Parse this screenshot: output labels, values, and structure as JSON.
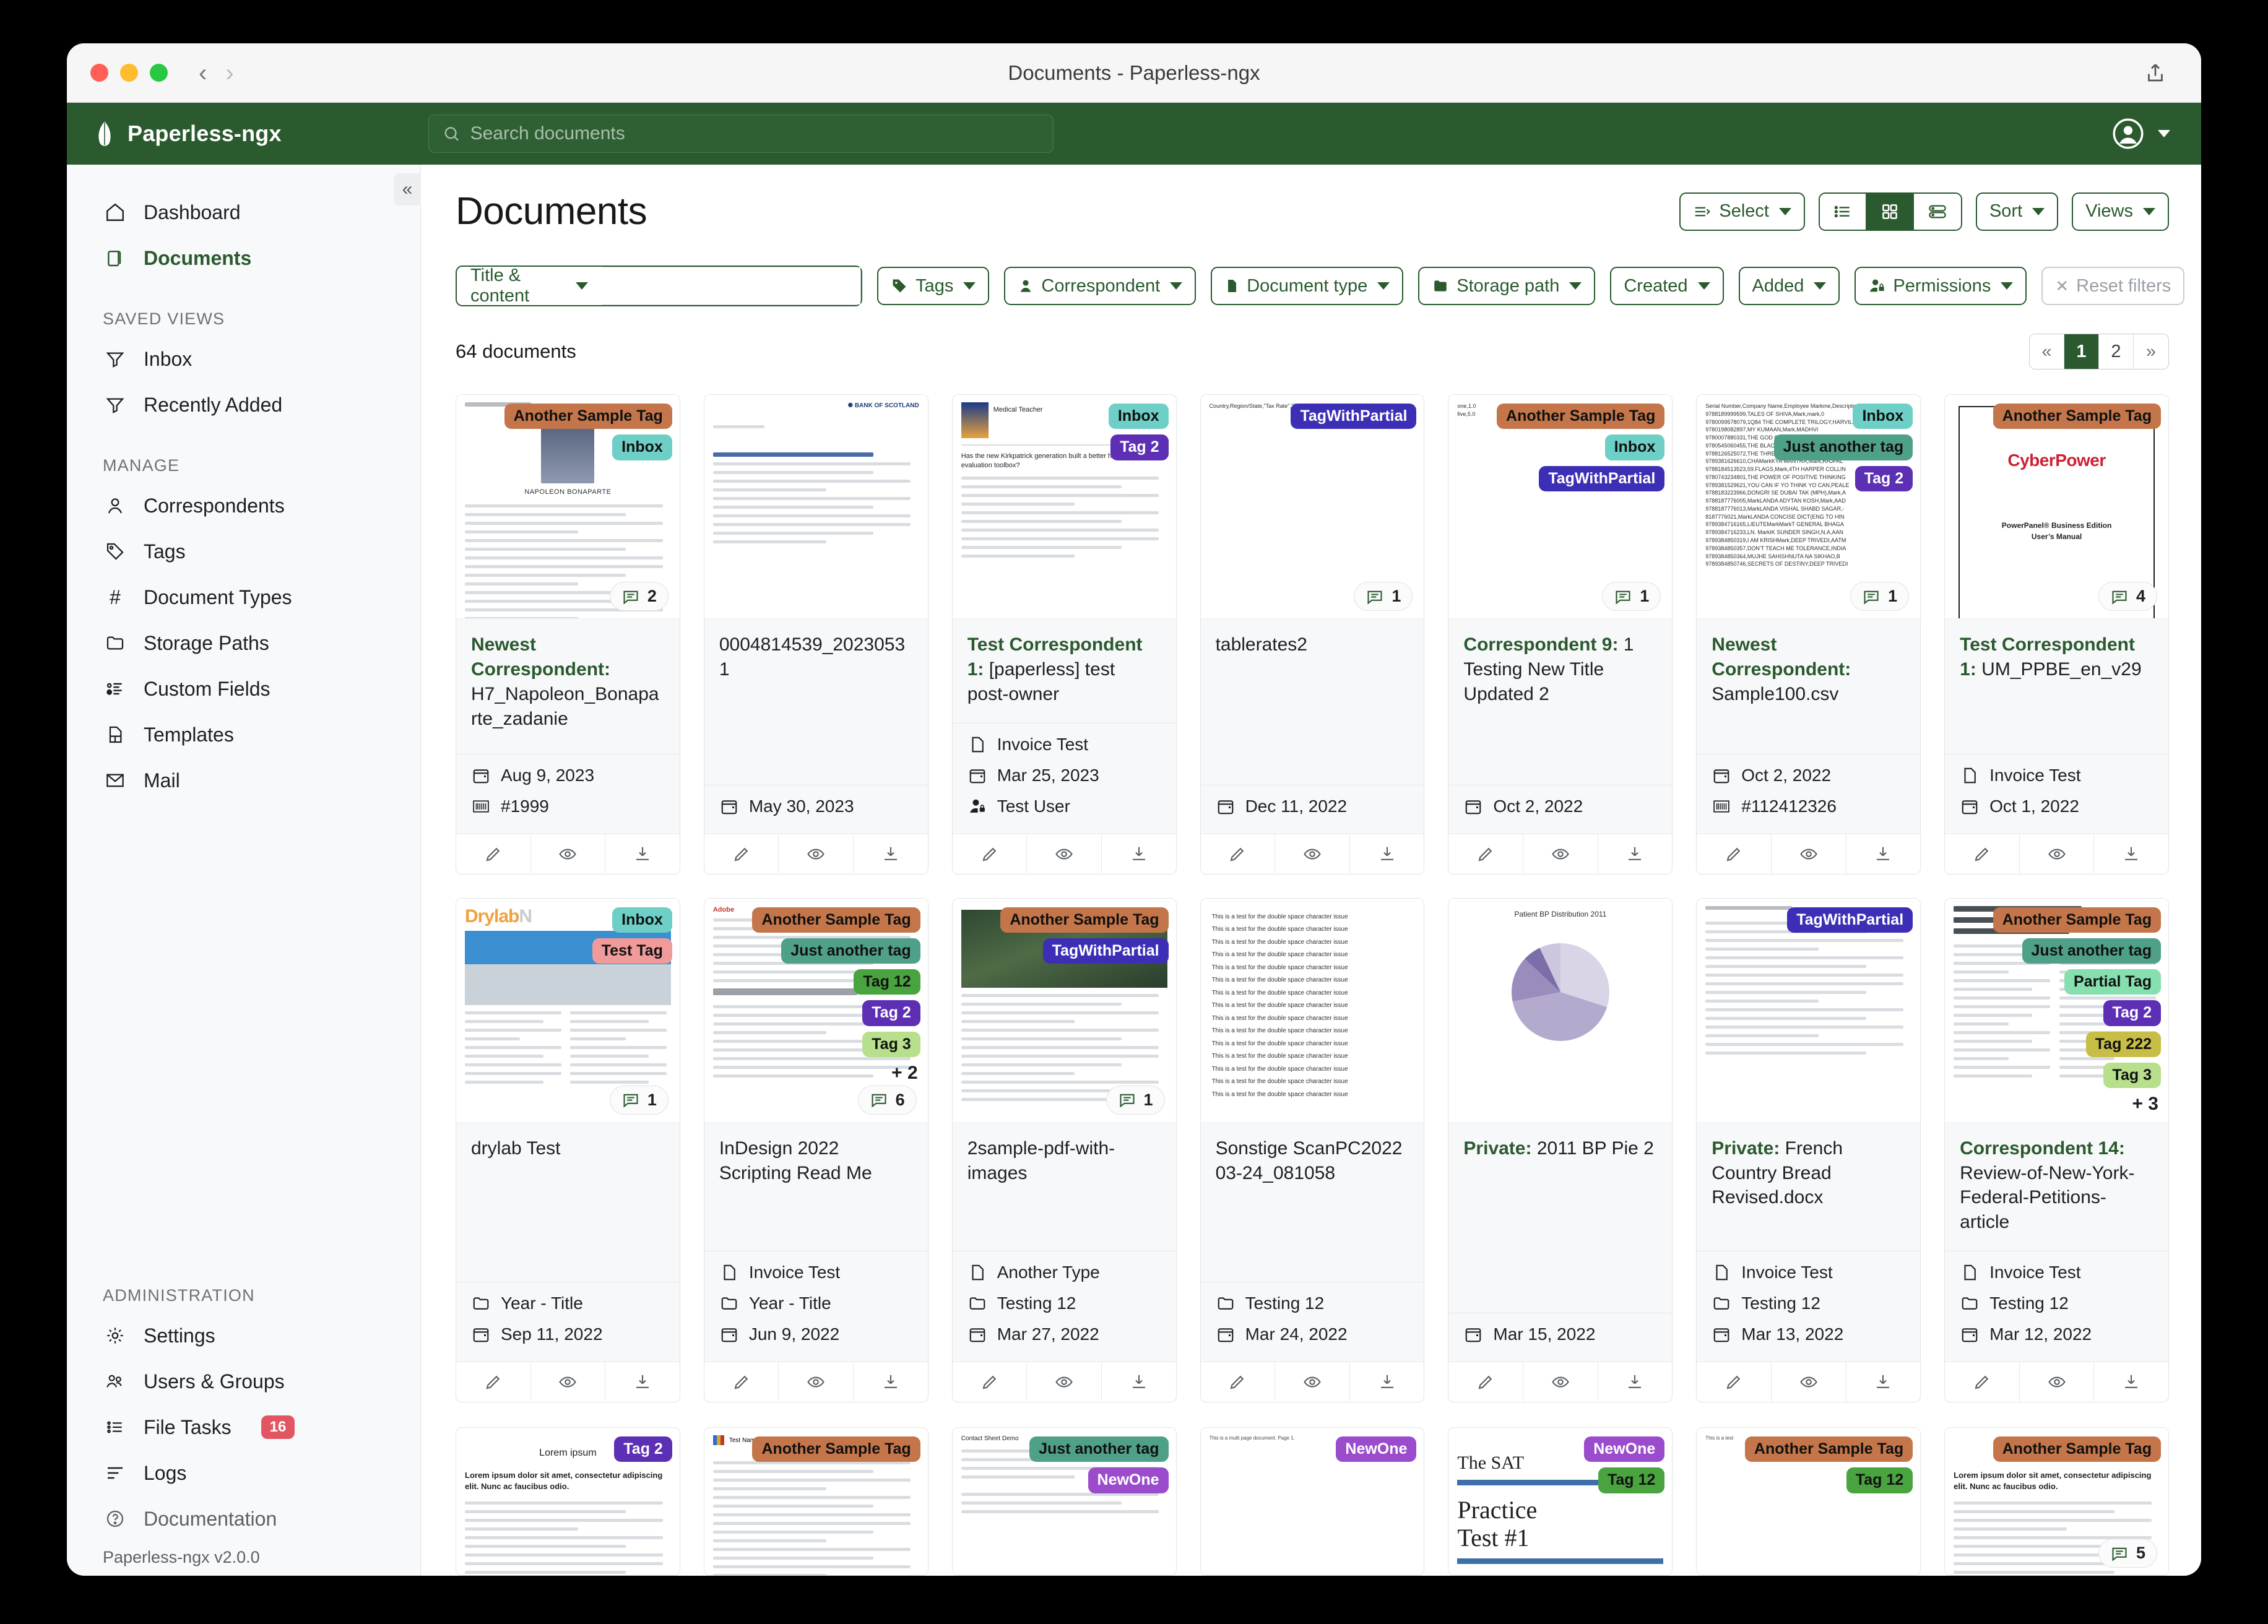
{
  "window": {
    "title": "Documents - Paperless-ngx"
  },
  "appbar": {
    "brand": "Paperless-ngx",
    "search_placeholder": "Search documents"
  },
  "sidebar": {
    "primary": [
      {
        "label": "Dashboard",
        "icon": "home-icon",
        "active": false
      },
      {
        "label": "Documents",
        "icon": "documents-icon",
        "active": true
      }
    ],
    "saved_views_heading": "SAVED VIEWS",
    "saved_views": [
      {
        "label": "Inbox",
        "icon": "filter-icon"
      },
      {
        "label": "Recently Added",
        "icon": "filter-icon"
      }
    ],
    "manage_heading": "MANAGE",
    "manage": [
      {
        "label": "Correspondents",
        "icon": "person-icon"
      },
      {
        "label": "Tags",
        "icon": "tag-icon"
      },
      {
        "label": "Document Types",
        "icon": "hash-icon"
      },
      {
        "label": "Storage Paths",
        "icon": "folder-icon"
      },
      {
        "label": "Custom Fields",
        "icon": "list-detail-icon"
      },
      {
        "label": "Templates",
        "icon": "template-icon"
      },
      {
        "label": "Mail",
        "icon": "mail-icon"
      }
    ],
    "administration_heading": "ADMINISTRATION",
    "administration": [
      {
        "label": "Settings",
        "icon": "gear-icon",
        "badge": ""
      },
      {
        "label": "Users & Groups",
        "icon": "users-icon",
        "badge": ""
      },
      {
        "label": "File Tasks",
        "icon": "tasks-icon",
        "badge": "16"
      },
      {
        "label": "Logs",
        "icon": "logs-icon",
        "badge": ""
      }
    ],
    "documentation": "Documentation",
    "version": "Paperless-ngx v2.0.0"
  },
  "main": {
    "page_title": "Documents",
    "select_label": "Select",
    "sort_label": "Sort",
    "views_label": "Views",
    "view_modes": [
      "list-view-icon",
      "grid-view-icon",
      "detail-view-icon"
    ],
    "view_mode_selected": 1,
    "title_content_label": "Title & content",
    "title_content_value": "",
    "filters": [
      {
        "label": "Tags",
        "icon": "tag-icon"
      },
      {
        "label": "Correspondent",
        "icon": "person-icon"
      },
      {
        "label": "Document type",
        "icon": "doctype-icon"
      },
      {
        "label": "Storage path",
        "icon": "folder-icon"
      },
      {
        "label": "Created",
        "icon": ""
      },
      {
        "label": "Added",
        "icon": ""
      },
      {
        "label": "Permissions",
        "icon": "permissions-icon"
      }
    ],
    "reset_filters_label": "Reset filters",
    "document_count": "64 documents",
    "pagination": {
      "first": "«",
      "pages": [
        "1",
        "2"
      ],
      "current": "1",
      "last": "»"
    }
  },
  "tag_colors": {
    "Another Sample Tag": "#c4764a",
    "Inbox": "#6ecfc6",
    "Tag 2": "#5c2fb5",
    "TagWithPartial": "#3c2fb5",
    "Just another tag": "#4fa088",
    "Test Tag": "#f09a9a",
    "Tag 12": "#49a43f",
    "Tag 3": "#b7df8c",
    "Tag 222": "#c8bd46",
    "Partial Tag": "#86dfae",
    "NewOne": "#9b4ccc"
  },
  "documents": [
    {
      "tags": [
        "Another Sample Tag",
        "Inbox"
      ],
      "comments": "2",
      "correspondent": "Newest Correspondent",
      "title": "H7_Napoleon_Bonaparte_zadanie",
      "details": [
        {
          "icon": "calendar-icon",
          "text": "Aug 9, 2023"
        },
        {
          "icon": "barcode-icon",
          "text": "#1999"
        }
      ],
      "thumb": "napoleon"
    },
    {
      "tags": [],
      "comments": "",
      "correspondent": "",
      "title": "0004814539_20230531",
      "details": [
        {
          "icon": "calendar-icon",
          "text": "May 30, 2023"
        }
      ],
      "thumb": "bank-letter"
    },
    {
      "tags": [
        "Inbox",
        "Tag 2"
      ],
      "comments": "",
      "correspondent": "Test Correspondent 1",
      "title": "[paperless] test post-owner",
      "details": [
        {
          "icon": "doc-icon",
          "text": "Invoice Test"
        },
        {
          "icon": "calendar-icon",
          "text": "Mar 25, 2023"
        },
        {
          "icon": "owner-icon",
          "text": "Test User"
        }
      ],
      "thumb": "journal"
    },
    {
      "tags": [
        "TagWithPartial"
      ],
      "comments": "1",
      "correspondent": "",
      "title": "tablerates2",
      "details": [
        {
          "icon": "calendar-icon",
          "text": "Dec 11, 2022"
        }
      ],
      "thumb": "csv-country"
    },
    {
      "tags": [
        "Another Sample Tag",
        "Inbox",
        "TagWithPartial"
      ],
      "comments": "1",
      "correspondent": "Correspondent 9",
      "title": "1 Testing New Title Updated 2",
      "details": [
        {
          "icon": "calendar-icon",
          "text": "Oct 2, 2022"
        }
      ],
      "thumb": "csv-onefive"
    },
    {
      "tags": [
        "Inbox",
        "Just another tag",
        "Tag 2"
      ],
      "comments": "1",
      "correspondent": "Newest Correspondent",
      "title": "Sample100.csv",
      "details": [
        {
          "icon": "calendar-icon",
          "text": "Oct 2, 2022"
        },
        {
          "icon": "barcode-icon",
          "text": "#112412326"
        }
      ],
      "thumb": "csv-books"
    },
    {
      "tags": [
        "Another Sample Tag"
      ],
      "comments": "4",
      "correspondent": "Test Correspondent 1",
      "title": "UM_PPBE_en_v29",
      "details": [
        {
          "icon": "doc-icon",
          "text": "Invoice Test"
        },
        {
          "icon": "calendar-icon",
          "text": "Oct 1, 2022"
        }
      ],
      "thumb": "cyberpower"
    },
    {
      "tags": [
        "Inbox",
        "Test Tag"
      ],
      "comments": "1",
      "correspondent": "",
      "title": "drylab Test",
      "details": [
        {
          "icon": "folder-icon",
          "text": "Year - Title"
        },
        {
          "icon": "calendar-icon",
          "text": "Sep 11, 2022"
        }
      ],
      "thumb": "drylab"
    },
    {
      "tags": [
        "Another Sample Tag",
        "Just another tag",
        "Tag 12",
        "Tag 2",
        "Tag 3"
      ],
      "extra_tags": "+ 2",
      "comments": "6",
      "correspondent": "",
      "title": "InDesign 2022 Scripting Read Me",
      "details": [
        {
          "icon": "doc-icon",
          "text": "Invoice Test"
        },
        {
          "icon": "folder-icon",
          "text": "Year - Title"
        },
        {
          "icon": "calendar-icon",
          "text": "Jun 9, 2022"
        }
      ],
      "thumb": "indesign"
    },
    {
      "tags": [
        "Another Sample Tag",
        "TagWithPartial"
      ],
      "comments": "1",
      "correspondent": "",
      "title": "2sample-pdf-with-images",
      "details": [
        {
          "icon": "doc-icon",
          "text": "Another Type"
        },
        {
          "icon": "folder-icon",
          "text": "Testing 12"
        },
        {
          "icon": "calendar-icon",
          "text": "Mar 27, 2022"
        }
      ],
      "thumb": "map-pdf"
    },
    {
      "tags": [],
      "comments": "",
      "correspondent": "",
      "title": "Sonstige ScanPC2022 03-24_081058",
      "details": [
        {
          "icon": "folder-icon",
          "text": "Testing 12"
        },
        {
          "icon": "calendar-icon",
          "text": "Mar 24, 2022"
        }
      ],
      "thumb": "doublespace"
    },
    {
      "tags": [],
      "comments": "",
      "correspondent": "Private",
      "title": "2011 BP Pie 2",
      "details": [
        {
          "icon": "calendar-icon",
          "text": "Mar 15, 2022"
        }
      ],
      "thumb": "pie"
    },
    {
      "tags": [
        "TagWithPartial"
      ],
      "comments": "",
      "correspondent": "Private",
      "title": "French Country Bread Revised.docx",
      "details": [
        {
          "icon": "doc-icon",
          "text": "Invoice Test"
        },
        {
          "icon": "folder-icon",
          "text": "Testing 12"
        },
        {
          "icon": "calendar-icon",
          "text": "Mar 13, 2022"
        }
      ],
      "thumb": "bread"
    },
    {
      "tags": [
        "Another Sample Tag",
        "Just another tag",
        "Partial Tag",
        "Tag 2",
        "Tag 222",
        "Tag 3"
      ],
      "extra_tags": "+ 3",
      "comments": "",
      "correspondent": "Correspondent 14",
      "title": "Review-of-New-York-Federal-Petitions-article",
      "details": [
        {
          "icon": "doc-icon",
          "text": "Invoice Test"
        },
        {
          "icon": "folder-icon",
          "text": "Testing 12"
        },
        {
          "icon": "calendar-icon",
          "text": "Mar 12, 2022"
        }
      ],
      "thumb": "review"
    }
  ],
  "documents_row3": [
    {
      "tags": [
        "Tag 2"
      ],
      "thumb": "lorem",
      "comments": ""
    },
    {
      "tags": [
        "Another Sample Tag"
      ],
      "thumb": "testname",
      "comments": ""
    },
    {
      "tags": [
        "Just another tag",
        "NewOne"
      ],
      "thumb": "contactsheet",
      "comments": ""
    },
    {
      "tags": [
        "NewOne"
      ],
      "thumb": "multipage",
      "comments": ""
    },
    {
      "tags": [
        "NewOne",
        "Tag 12"
      ],
      "thumb": "sat",
      "comments": ""
    },
    {
      "tags": [
        "Another Sample Tag",
        "Tag 12"
      ],
      "thumb": "testpage",
      "comments": ""
    },
    {
      "tags": [
        "Another Sample Tag"
      ],
      "thumb": "lorem2",
      "comments": "5"
    }
  ]
}
